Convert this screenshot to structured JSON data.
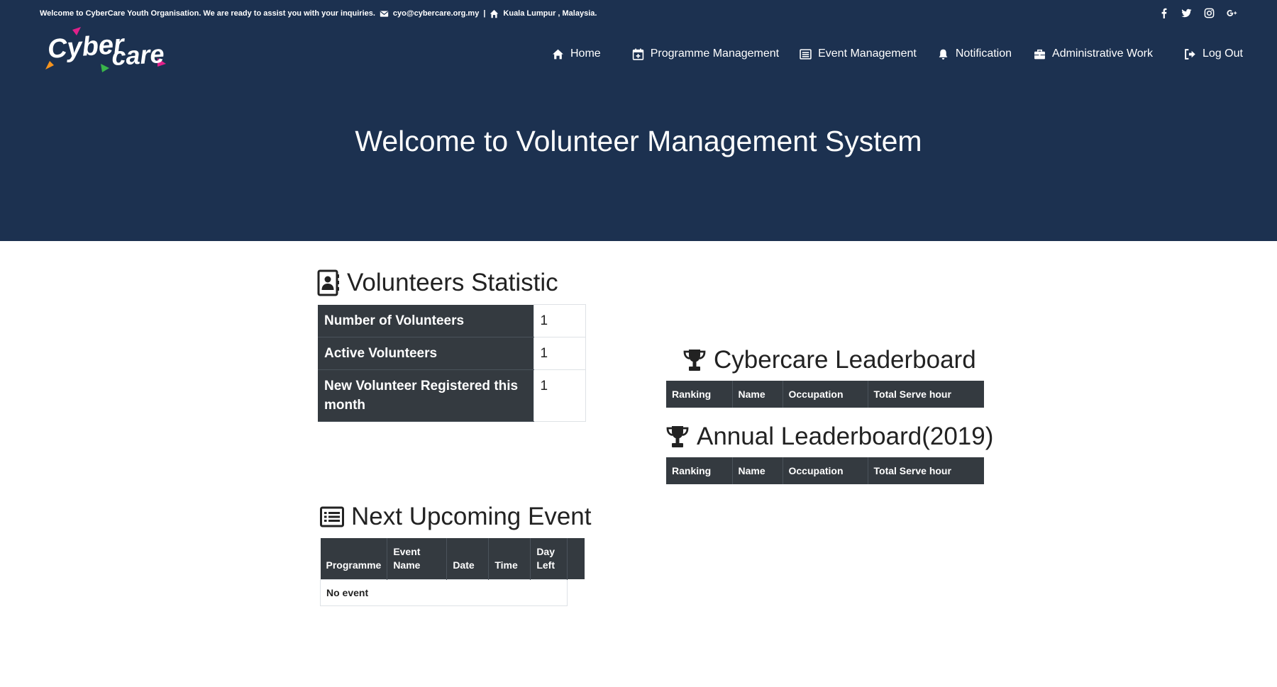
{
  "topbar": {
    "welcome": "Welcome to CyberCare Youth Organisation. We are ready to assist you with your inquiries.",
    "email": "cyo@cybercare.org.my",
    "separator": "|",
    "address": "Kuala Lumpur , Malaysia."
  },
  "social": [
    {
      "name": "facebook-icon"
    },
    {
      "name": "twitter-icon"
    },
    {
      "name": "instagram-icon"
    },
    {
      "name": "google-plus-icon"
    }
  ],
  "logo": {
    "text": "Cyber care"
  },
  "nav": {
    "home": "Home",
    "programme": "Programme Management",
    "event": "Event Management",
    "notification": "Notification",
    "admin": "Administrative Work",
    "logout": "Log Out"
  },
  "hero": {
    "title": "Welcome to Volunteer Management System"
  },
  "stats": {
    "title": "Volunteers Statistic",
    "rows": [
      {
        "label": "Number of Volunteers",
        "value": "1"
      },
      {
        "label": "Active Volunteers",
        "value": "1"
      },
      {
        "label": "New Volunteer Registered this month",
        "value": "1"
      }
    ]
  },
  "leaderboard": {
    "title": "Cybercare Leaderboard",
    "columns": [
      "Ranking",
      "Name",
      "Occupation",
      "Total Serve hour"
    ]
  },
  "annual": {
    "title": "Annual Leaderboard(2019)",
    "columns": [
      "Ranking",
      "Name",
      "Occupation",
      "Total Serve hour"
    ]
  },
  "events": {
    "title": "Next Upcoming Event",
    "columns": [
      "Programme",
      "Event Name",
      "Date",
      "Time",
      "Day Left",
      ""
    ],
    "empty": "No event"
  },
  "colors": {
    "header_bg": "#1c3150",
    "table_header_bg": "#343a40",
    "text_white": "#ffffff",
    "logo_orange": "#f7941d",
    "logo_pink": "#e0218a",
    "logo_green": "#39b54a"
  }
}
